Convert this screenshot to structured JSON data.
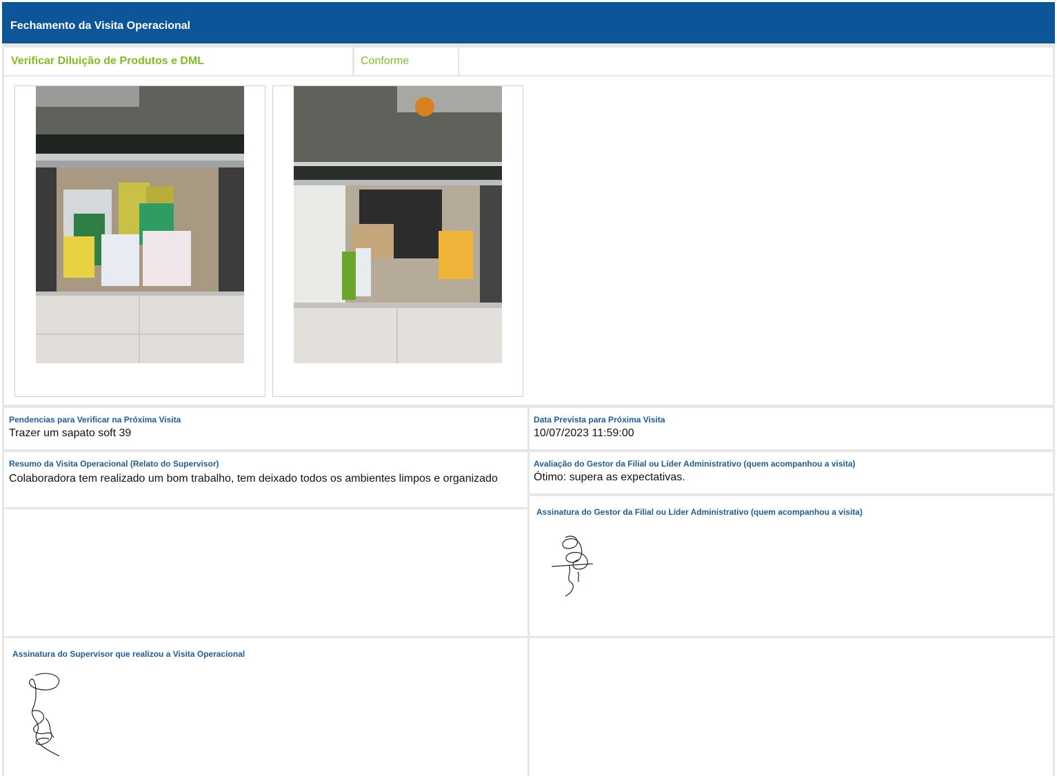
{
  "header": {
    "title": "Fechamento da Visita Operacional"
  },
  "item": {
    "name": "Verificar Diluição de Produtos e DML",
    "status": "Conforme"
  },
  "photos": [
    {
      "name": "photo-under-sink-1",
      "kind": "photo of cleaning products under a sink"
    },
    {
      "name": "photo-under-sink-2",
      "kind": "photo of cleaning products under a sink"
    }
  ],
  "pendencias": {
    "label": "Pendencias para Verificar na Próxima Visita",
    "value": "Trazer um sapato soft 39"
  },
  "data_prevista": {
    "label": "Data Prevista para Próxima Visita",
    "value": "10/07/2023 11:59:00"
  },
  "resumo": {
    "label": "Resumo da Visita Operacional (Relato do Supervisor)",
    "value": "Colaboradora tem realizado um bom trabalho, tem deixado todos os ambientes limpos e organizado"
  },
  "avaliacao": {
    "label": "Avaliação do Gestor da Filial ou Líder Administrativo (quem acompanhou a visita)",
    "value": "Ótimo: supera as expectativas."
  },
  "assinatura_gestor": {
    "label": "Assinatura do Gestor da Filial ou Líder Administrativo (quem acompanhou a visita)"
  },
  "assinatura_supervisor": {
    "label": "Assinatura do Supervisor que realizou a Visita Operacional"
  },
  "colors": {
    "header_bg": "#0b5598",
    "accent_green": "#7dbf1f",
    "label_blue": "#1a5d9c"
  }
}
